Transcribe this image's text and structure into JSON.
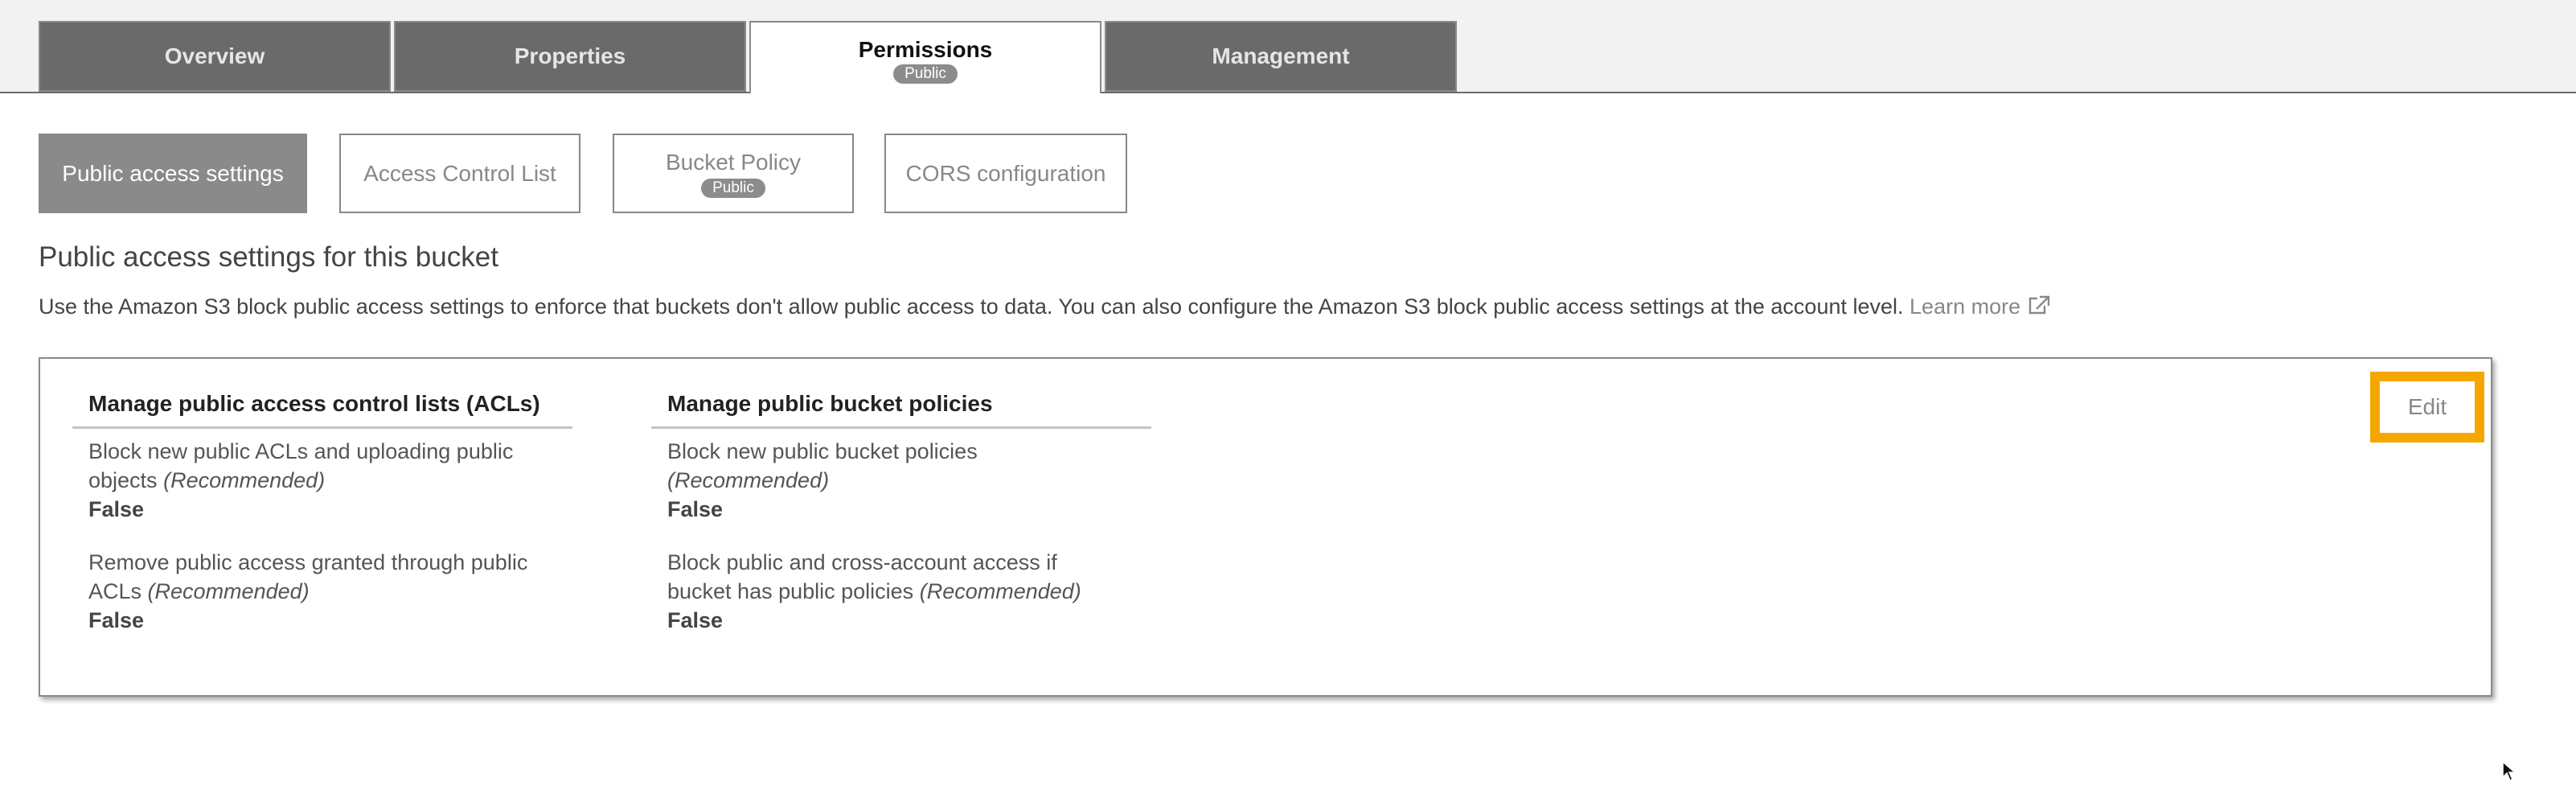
{
  "tabs": [
    {
      "label": "Overview"
    },
    {
      "label": "Properties"
    },
    {
      "label": "Permissions",
      "badge": "Public",
      "active": true
    },
    {
      "label": "Management"
    }
  ],
  "subtabs": [
    {
      "label": "Public access settings",
      "active": true
    },
    {
      "label": "Access Control List"
    },
    {
      "label": "Bucket Policy",
      "badge": "Public"
    },
    {
      "label": "CORS configuration"
    }
  ],
  "section": {
    "title": "Public access settings for this bucket",
    "description": "Use the Amazon S3 block public access settings to enforce that buckets don't allow public access to data. You can also configure the Amazon S3 block public access settings at the account level.",
    "learn_more": "Learn more"
  },
  "acl_column": {
    "heading": "Manage public access control lists (ACLs)",
    "settings": [
      {
        "line1": "Block new public ACLs and uploading public",
        "line2": "objects",
        "rec": "(Recommended)",
        "value": "False"
      },
      {
        "line1": "Remove public access granted through public",
        "line2": "ACLs",
        "rec": "(Recommended)",
        "value": "False"
      }
    ]
  },
  "policy_column": {
    "heading": "Manage public bucket policies",
    "settings": [
      {
        "line1": "Block new public bucket policies",
        "line2": "",
        "rec": "(Recommended)",
        "value": "False"
      },
      {
        "line1": "Block public and cross-account access if",
        "line2": "bucket has public policies",
        "rec": "(Recommended)",
        "value": "False"
      }
    ]
  },
  "edit_button": {
    "label": "Edit"
  },
  "colors": {
    "highlight": "#f5a700",
    "tab_bg": "#6a6a6a",
    "pill": "#8c8c8c"
  }
}
